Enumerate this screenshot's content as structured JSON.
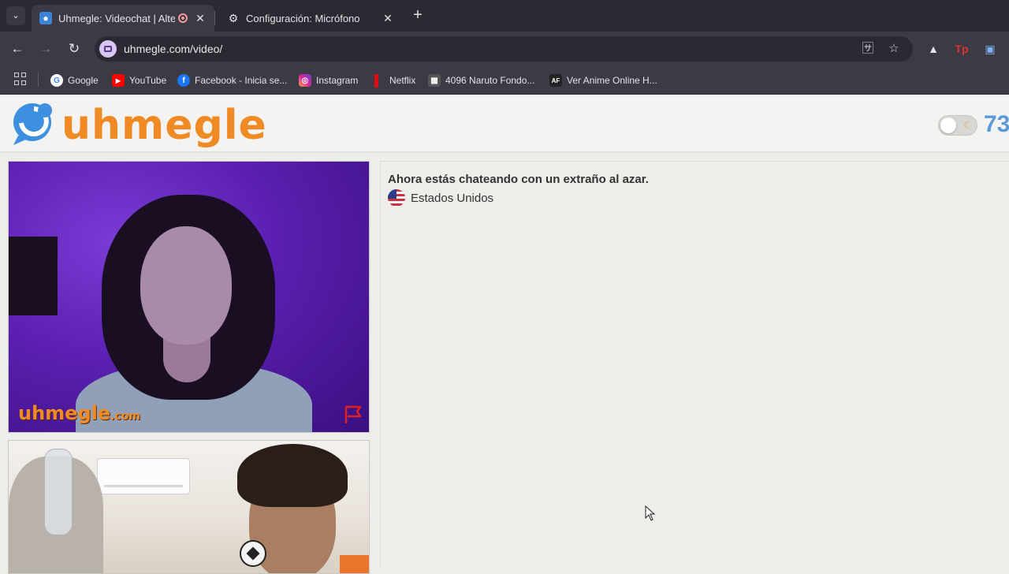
{
  "browser": {
    "tabs": [
      {
        "title": "Uhmegle: Videochat | Altern",
        "active": true,
        "recording": true
      },
      {
        "title": "Configuración: Micrófono",
        "active": false
      }
    ],
    "url": "uhmegle.com/video/",
    "bookmarks": [
      {
        "label": "Google",
        "icon": "google-icon"
      },
      {
        "label": "YouTube",
        "icon": "youtube-icon"
      },
      {
        "label": "Facebook - Inicia se...",
        "icon": "facebook-icon"
      },
      {
        "label": "Instagram",
        "icon": "instagram-icon"
      },
      {
        "label": "Netflix",
        "icon": "netflix-icon"
      },
      {
        "label": "4096 Naruto Fondo...",
        "icon": "image-icon"
      },
      {
        "label": "Ver Anime Online H...",
        "icon": "anime-icon",
        "badge": "AF"
      }
    ]
  },
  "site": {
    "logo": "uhmegle",
    "online_count": "73",
    "watermark": "uhmegle",
    "watermark_suffix": ".com"
  },
  "chat": {
    "status": "Ahora estás chateando con un extraño al azar.",
    "country": "Estados Unidos"
  },
  "colors": {
    "brand_orange": "#f08a24",
    "brand_blue": "#5a9ad6",
    "chrome_dark": "#2b2a33",
    "chrome_mid": "#3c3b45"
  }
}
